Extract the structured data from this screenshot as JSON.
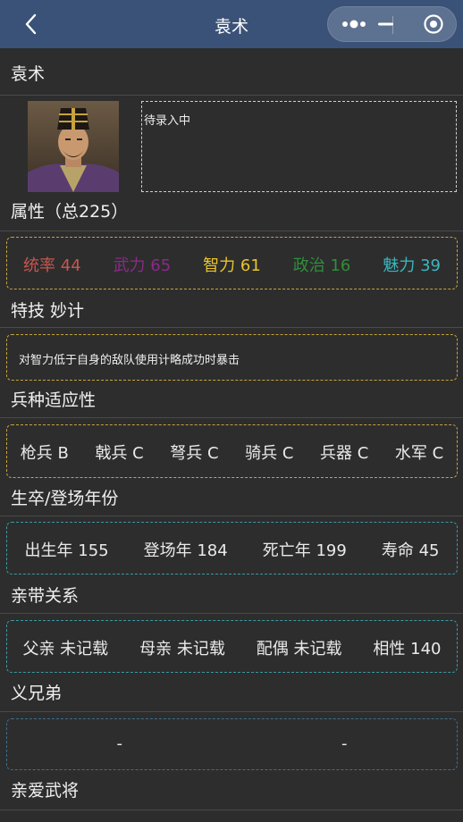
{
  "nav": {
    "title": "袁术",
    "back_icon": "chevron-left-icon",
    "more_icon": "more-dots-icon",
    "minimize_icon": "minus-icon",
    "close_icon": "target-circle-icon"
  },
  "general": {
    "name": "袁术",
    "portrait": "portrait-yuan-shu",
    "bio": "待录入中"
  },
  "attributes": {
    "heading": "属性（总225）",
    "items": [
      {
        "label": "统率 44",
        "color": "#c8554f"
      },
      {
        "label": "武力 65",
        "color": "#8a2a8a"
      },
      {
        "label": "智力 61",
        "color": "#e8c52a"
      },
      {
        "label": "政治 16",
        "color": "#2f8f3a"
      },
      {
        "label": "魅力 39",
        "color": "#3ab7c0"
      }
    ]
  },
  "skill": {
    "heading": "特技 妙计",
    "desc": "对智力低于自身的敌队使用计略成功时暴击"
  },
  "troops": {
    "heading": "兵种适应性",
    "items": [
      "枪兵 B",
      "戟兵 C",
      "弩兵 C",
      "骑兵 C",
      "兵器 C",
      "水军 C"
    ]
  },
  "years": {
    "heading": "生卒/登场年份",
    "items": [
      "出生年 155",
      "登场年 184",
      "死亡年 199",
      "寿命 45"
    ]
  },
  "family": {
    "heading": "亲带关系",
    "items": [
      "父亲 未记载",
      "母亲 未记载",
      "配偶 未记载",
      "相性 140"
    ]
  },
  "sworn": {
    "heading": "义兄弟",
    "items": [
      "-",
      "-"
    ]
  },
  "favorite": {
    "heading": "亲爱武将"
  }
}
